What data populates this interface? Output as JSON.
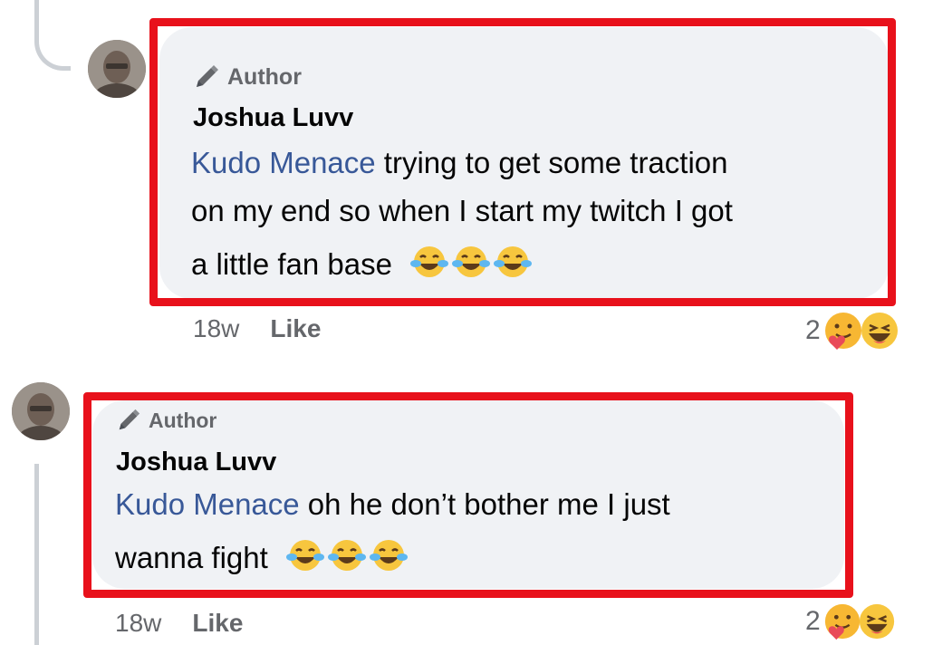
{
  "comments": [
    {
      "badge": "Author",
      "badge_icon": "pen-icon",
      "name": "Joshua Luvv",
      "mention": "Kudo Menace",
      "line1_rest": " trying to get some traction",
      "line2": "on my end so when I start my twitch I got",
      "line3": "a little fan base",
      "emojis": [
        "tears-of-joy-emoji",
        "tears-of-joy-emoji",
        "tears-of-joy-emoji"
      ],
      "time": "18w",
      "like_label": "Like",
      "reaction_count": "2",
      "reaction_icons": [
        "care-reaction-icon",
        "haha-reaction-icon"
      ]
    },
    {
      "badge": "Author",
      "badge_icon": "pen-icon",
      "name": "Joshua Luvv",
      "mention": "Kudo Menace",
      "line1_rest": " oh he don’t bother me I just",
      "line2": "wanna fight",
      "emojis": [
        "tears-of-joy-emoji",
        "tears-of-joy-emoji",
        "tears-of-joy-emoji"
      ],
      "time": "18w",
      "like_label": "Like",
      "reaction_count": "2",
      "reaction_icons": [
        "care-reaction-icon",
        "haha-reaction-icon"
      ]
    }
  ],
  "colors": {
    "highlight": "#e8111b",
    "mention": "#385898",
    "bubble": "#f0f2f5",
    "meta": "#65676b"
  }
}
